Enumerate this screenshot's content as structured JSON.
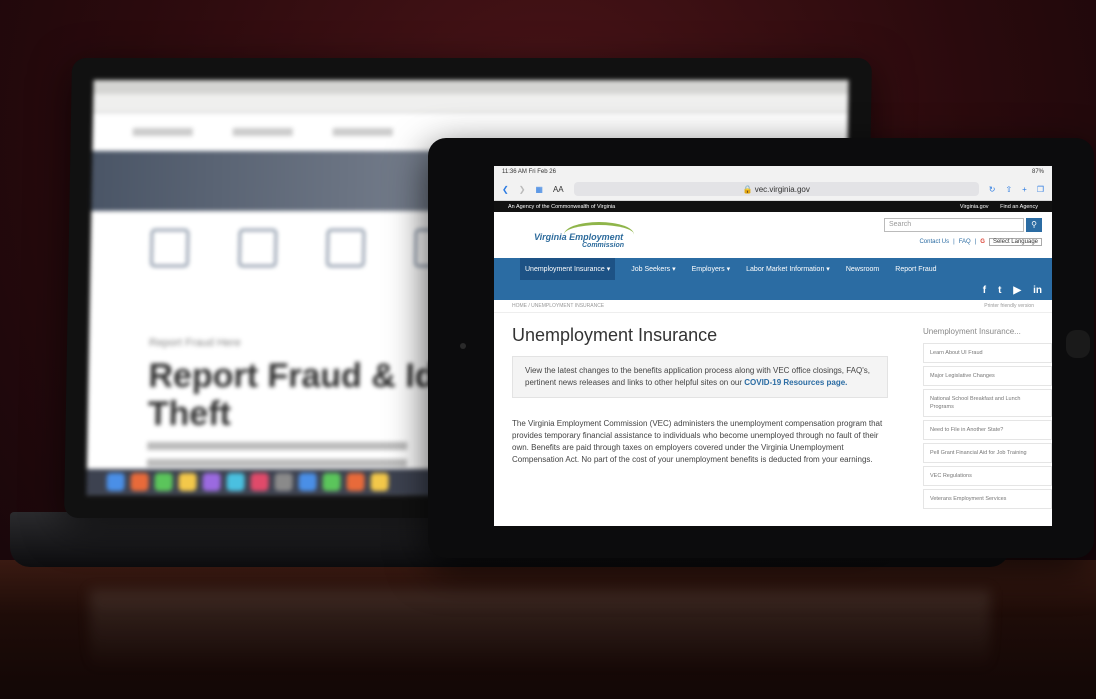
{
  "laptop": {
    "page_crumb": "Report Fraud Here",
    "page_heading_line1": "Report Fraud & Ide",
    "page_heading_line2": "Theft"
  },
  "tablet": {
    "status": {
      "time": "11:36 AM  Fri Feb 26",
      "battery": "87%"
    },
    "browser": {
      "text_size_label": "AA",
      "url": "vec.virginia.gov"
    },
    "gov_bar": {
      "agency": "An Agency of the Commonwealth of Virginia",
      "links": [
        "Virginia.gov",
        "Find an Agency"
      ]
    },
    "header": {
      "logo_line1": "Virginia Employment",
      "logo_line2": "Commission",
      "search_placeholder": "Search",
      "contact": "Contact Us",
      "faq": "FAQ",
      "language": "Select Language"
    },
    "nav": [
      "Unemployment Insurance ▾",
      "Job Seekers ▾",
      "Employers ▾",
      "Labor Market Information ▾",
      "Newsroom",
      "Report Fraud"
    ],
    "social": [
      "f",
      "t",
      "▶",
      "in"
    ],
    "breadcrumb": "HOME / UNEMPLOYMENT INSURANCE",
    "printer_friendly": "Printer friendly version",
    "title": "Unemployment Insurance",
    "notice_text": "View the latest changes to the benefits application process along with VEC office closings, FAQ's, pertinent news releases and links to other helpful sites on our ",
    "notice_link": "COVID-19 Resources page.",
    "paragraph": "The Virginia Employment Commission (VEC) administers the unemployment compensation program that provides temporary financial assistance to individuals who become unemployed through no fault of their own. Benefits are paid through taxes on employers covered under the Virginia Unemployment Compensation Act. No part of the cost of your unemployment benefits is deducted from your earnings.",
    "sidebar": {
      "title": "Unemployment Insurance...",
      "items": [
        "Learn About UI Fraud",
        "Major Legislative Changes",
        "National School Breakfast and Lunch Programs",
        "Need to File in Another State?",
        "Pell Grant Financial Aid for Job Training",
        "VEC Regulations",
        "Veterans Employment Services"
      ]
    }
  }
}
